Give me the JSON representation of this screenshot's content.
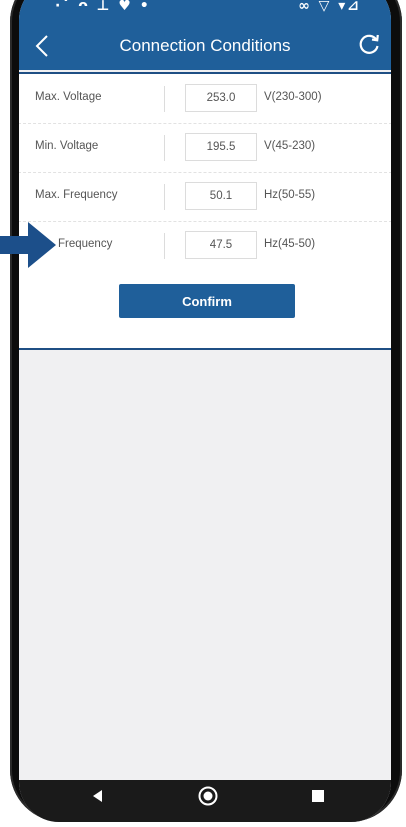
{
  "status_bar": {
    "left_icons": "·ˇ ᴖ ⊥ ♥ •",
    "right_icons": "∞ ▽ ▾⊿"
  },
  "header": {
    "title": "Connection Conditions",
    "back_icon": "chevron-left-icon",
    "refresh_icon": "refresh-icon"
  },
  "form": {
    "rows": [
      {
        "label": "Max. Voltage",
        "value": "253.0",
        "range": "V(230-300)"
      },
      {
        "label": "Min. Voltage",
        "value": "195.5",
        "range": "V(45-230)"
      },
      {
        "label": "Max. Frequency",
        "value": "50.1",
        "range": "Hz(50-55)"
      },
      {
        "label": "Frequency",
        "value": "47.5",
        "range": "Hz(45-50)"
      }
    ],
    "confirm_label": "Confirm"
  },
  "nav_bar": {
    "back_icon": "triangle-back-icon",
    "home_icon": "circle-home-icon",
    "recents_icon": "square-recents-icon"
  },
  "colors": {
    "header_blue": "#1f5f9a",
    "card_border": "#1f4f84",
    "arrow_blue": "#1c4f8a",
    "screen_background": "#f0f0f2",
    "phone_frame": "#0c0c0c"
  }
}
